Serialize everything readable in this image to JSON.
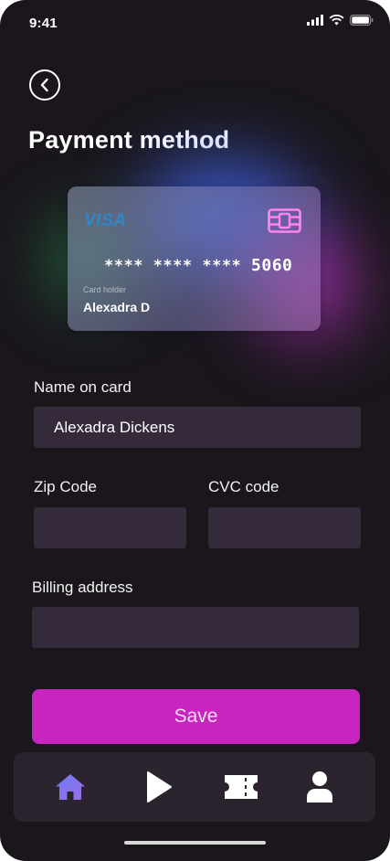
{
  "status_bar": {
    "time": "9:41"
  },
  "header": {
    "title": "Payment method",
    "back_icon": "chevron-left-icon"
  },
  "card": {
    "brand": "VISA",
    "masked_prefix": "**** **** ****",
    "last_digits": "5060",
    "holder_label": "Card holder",
    "holder_name": "Alexadra D"
  },
  "form": {
    "name_label": "Name on card",
    "name_value": "Alexadra Dickens",
    "zip_label": "Zip Code",
    "zip_value": "",
    "cvc_label": "CVC code",
    "cvc_value": "",
    "billing_label": "Billing address",
    "billing_value": ""
  },
  "actions": {
    "save_label": "Save"
  },
  "bottom_nav": {
    "items": [
      {
        "icon": "home-icon",
        "active": true
      },
      {
        "icon": "play-icon",
        "active": false
      },
      {
        "icon": "ticket-icon",
        "active": false
      },
      {
        "icon": "user-icon",
        "active": false
      }
    ]
  },
  "colors": {
    "background": "#1a161c",
    "input_background": "#342a3a",
    "accent": "#c724c0",
    "nav_active": "#7b6cf0",
    "chip": "#ff86f0"
  }
}
